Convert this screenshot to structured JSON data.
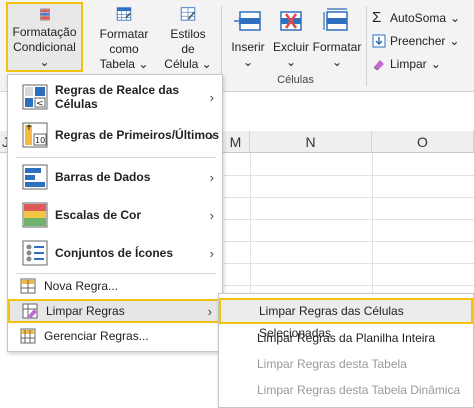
{
  "ribbon": {
    "conditional_formatting": {
      "line1": "Formatação",
      "line2": "Condicional"
    },
    "format_as_table": {
      "line1": "Formatar como",
      "line2": "Tabela"
    },
    "cell_styles": {
      "line1": "Estilos de",
      "line2": "Célula"
    },
    "insert": {
      "line1": "Inserir"
    },
    "delete": {
      "line1": "Excluir"
    },
    "format": {
      "line1": "Formatar"
    },
    "cells_group_label": "Células",
    "editing": {
      "autosum": "AutoSoma",
      "fill": "Preencher",
      "clear": "Limpar"
    },
    "chevron": "⌄"
  },
  "grid": {
    "columns": [
      "J",
      "M",
      "N",
      "O"
    ]
  },
  "menu": {
    "items": [
      {
        "label": "Regras de Realce das Células",
        "icon": "highlight-cells-rules-icon",
        "submenu": true
      },
      {
        "label": "Regras de Primeiros/Últimos",
        "icon": "top-bottom-rules-icon",
        "submenu": true
      },
      {
        "label": "Barras de Dados",
        "icon": "data-bars-icon",
        "submenu": true
      },
      {
        "label": "Escalas de Cor",
        "icon": "color-scales-icon",
        "submenu": true
      },
      {
        "label": "Conjuntos de Ícones",
        "icon": "icon-sets-icon",
        "submenu": true
      }
    ],
    "new_rule": "Nova Regra...",
    "clear_rules": "Limpar Regras",
    "manage_rules": "Gerenciar Regras...",
    "arrow": "›"
  },
  "submenu": {
    "items": [
      {
        "label": "Limpar Regras das Células Selecionadas",
        "enabled": true
      },
      {
        "label": "Limpar Regras da Planilha Inteira",
        "enabled": true
      },
      {
        "label": "Limpar Regras desta Tabela",
        "enabled": false
      },
      {
        "label": "Limpar Regras desta Tabela Dinâmica",
        "enabled": false
      }
    ]
  },
  "colors": {
    "highlight_border": "#f4c20d",
    "accent_blue": "#2f6fbf",
    "accent_red": "#e04a4a"
  }
}
